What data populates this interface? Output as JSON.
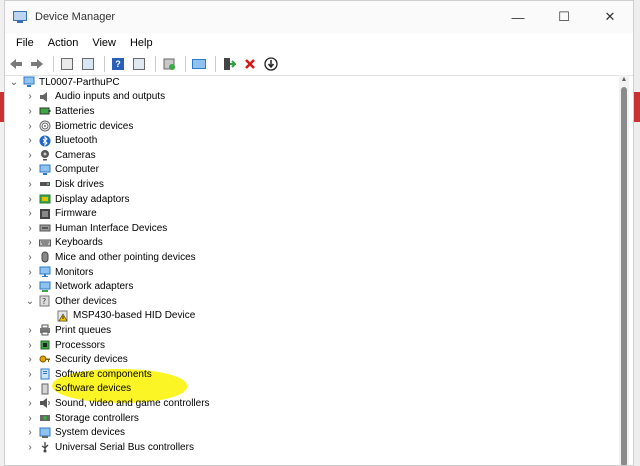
{
  "window": {
    "title": "Device Manager",
    "minimize_glyph": "—",
    "maximize_glyph": "☐",
    "close_glyph": "✕"
  },
  "menu": [
    "File",
    "Action",
    "View",
    "Help"
  ],
  "toolbar_icons": [
    "back-arrow-icon",
    "forward-arrow-icon",
    "properties-icon",
    "scan-icon",
    "help-icon",
    "view-icon",
    "update-driver-icon",
    "monitor-icon",
    "enable-device-icon",
    "uninstall-x-icon",
    "download-icon"
  ],
  "tree": {
    "root": "TL0007-ParthuPC",
    "items": [
      {
        "label": "Audio inputs and outputs",
        "icon": "speaker-icon",
        "expander": "›"
      },
      {
        "label": "Batteries",
        "icon": "battery-icon",
        "expander": "›"
      },
      {
        "label": "Biometric devices",
        "icon": "fingerprint-icon",
        "expander": "›"
      },
      {
        "label": "Bluetooth",
        "icon": "bluetooth-icon",
        "expander": "›"
      },
      {
        "label": "Cameras",
        "icon": "camera-icon",
        "expander": "›"
      },
      {
        "label": "Computer",
        "icon": "computer-icon",
        "expander": "›"
      },
      {
        "label": "Disk drives",
        "icon": "disk-icon",
        "expander": "›"
      },
      {
        "label": "Display adaptors",
        "icon": "display-adapter-icon",
        "expander": "›"
      },
      {
        "label": "Firmware",
        "icon": "firmware-icon",
        "expander": "›"
      },
      {
        "label": "Human Interface Devices",
        "icon": "hid-icon",
        "expander": "›"
      },
      {
        "label": "Keyboards",
        "icon": "keyboard-icon",
        "expander": "›"
      },
      {
        "label": "Mice and other pointing devices",
        "icon": "mouse-icon",
        "expander": "›"
      },
      {
        "label": "Monitors",
        "icon": "monitor-icon",
        "expander": "›"
      },
      {
        "label": "Network adapters",
        "icon": "network-icon",
        "expander": "›"
      },
      {
        "label": "Other devices",
        "icon": "unknown-device-icon",
        "expander": "⌄"
      },
      {
        "label": "MSP430-based HID Device",
        "icon": "warning-device-icon",
        "expander": "",
        "child": true
      },
      {
        "label": "Print queues",
        "icon": "printer-icon",
        "expander": "›"
      },
      {
        "label": "Processors",
        "icon": "processor-icon",
        "expander": "›"
      },
      {
        "label": "Security devices",
        "icon": "security-icon",
        "expander": "›"
      },
      {
        "label": "Software components",
        "icon": "software-component-icon",
        "expander": "›"
      },
      {
        "label": "Software devices",
        "icon": "software-device-icon",
        "expander": "›"
      },
      {
        "label": "Sound, video and game controllers",
        "icon": "sound-icon",
        "expander": "›"
      },
      {
        "label": "Storage controllers",
        "icon": "storage-icon",
        "expander": "›"
      },
      {
        "label": "System devices",
        "icon": "system-icon",
        "expander": "›"
      },
      {
        "label": "Universal Serial Bus controllers",
        "icon": "usb-icon",
        "expander": "›"
      }
    ]
  },
  "colors": {
    "highlight": "#fcf41a",
    "accent_blue": "#2b79c9",
    "scroll_thumb": "#8b8b8b"
  }
}
